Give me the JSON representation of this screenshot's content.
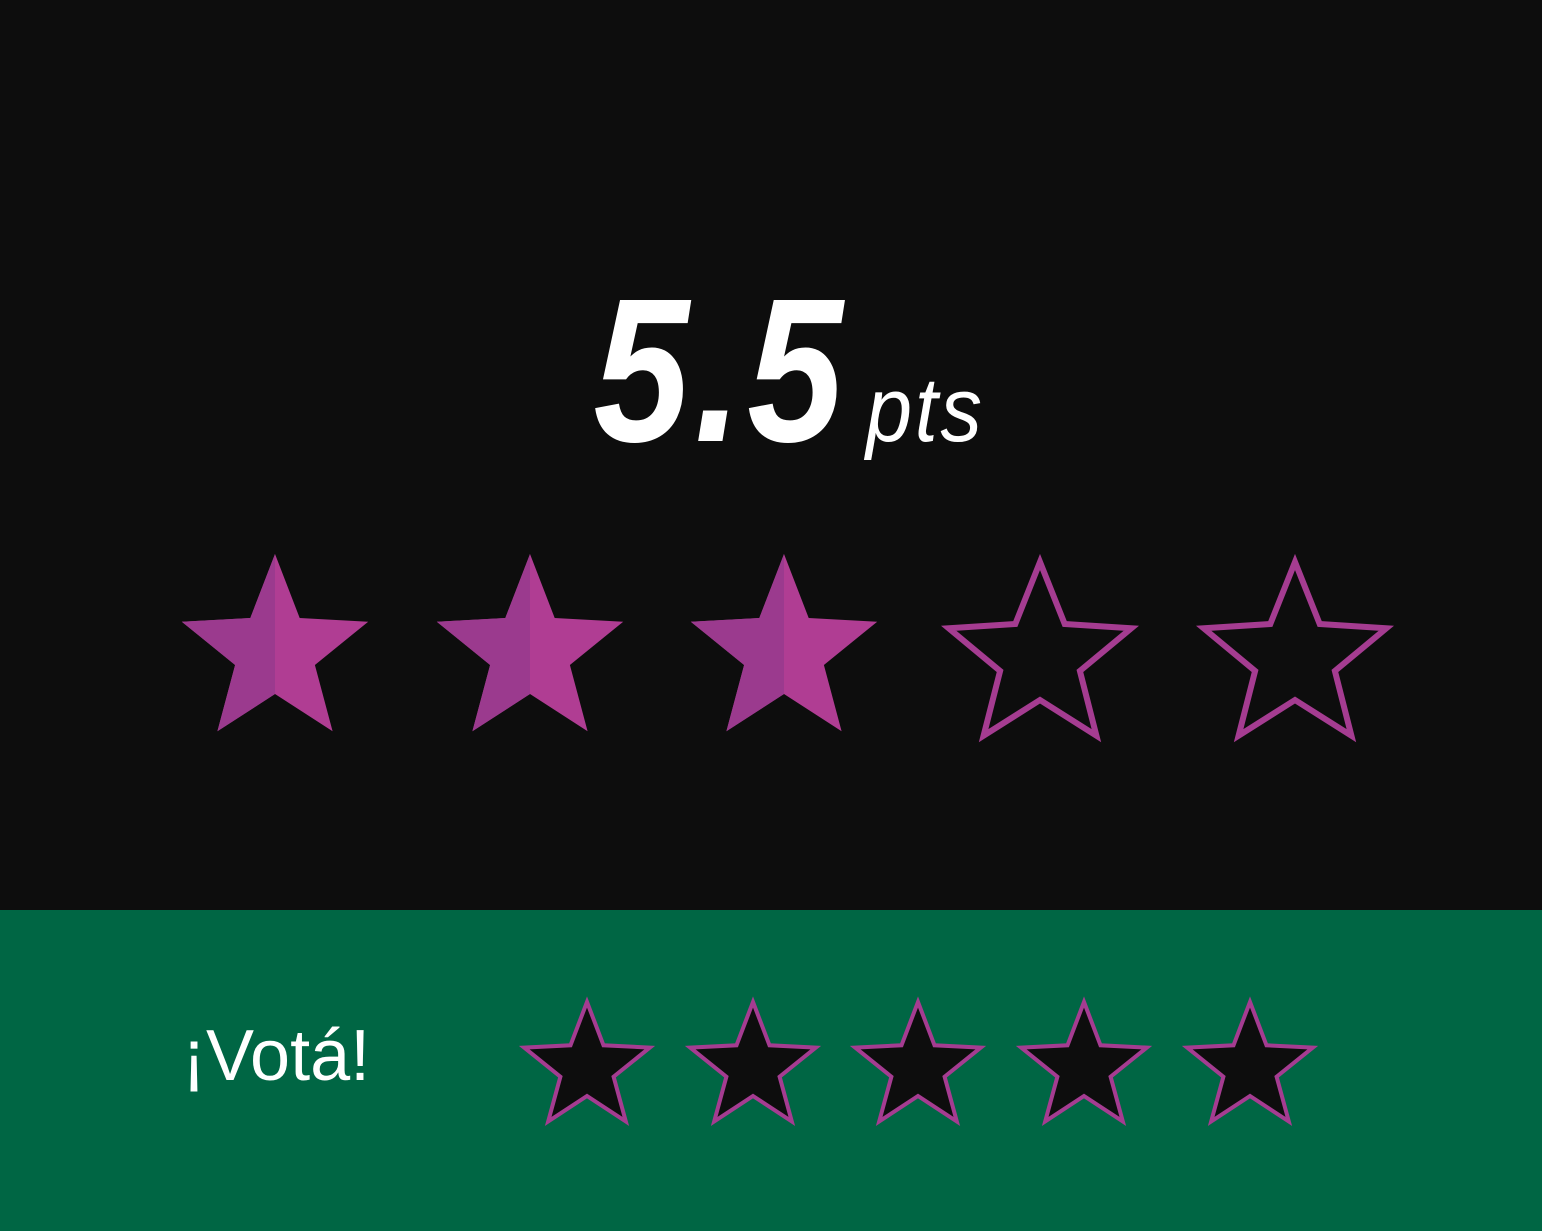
{
  "rating": {
    "score": "5.5",
    "unit": "pts",
    "stars_total": 5,
    "stars_filled": 3,
    "fill_color": "#b03d93",
    "fill_shade_color": "#9b3a8e",
    "outline_color": "#a53c91",
    "star_icon": "star-icon"
  },
  "vote": {
    "label": "¡Votá!",
    "stars_total": 5,
    "star_fill_color": "#0d0d0d",
    "star_outline_color": "#a53c91",
    "background_color": "#006644",
    "star_icon": "star-outline-icon"
  },
  "colors": {
    "panel_background": "#0d0d0d",
    "text": "#ffffff"
  }
}
